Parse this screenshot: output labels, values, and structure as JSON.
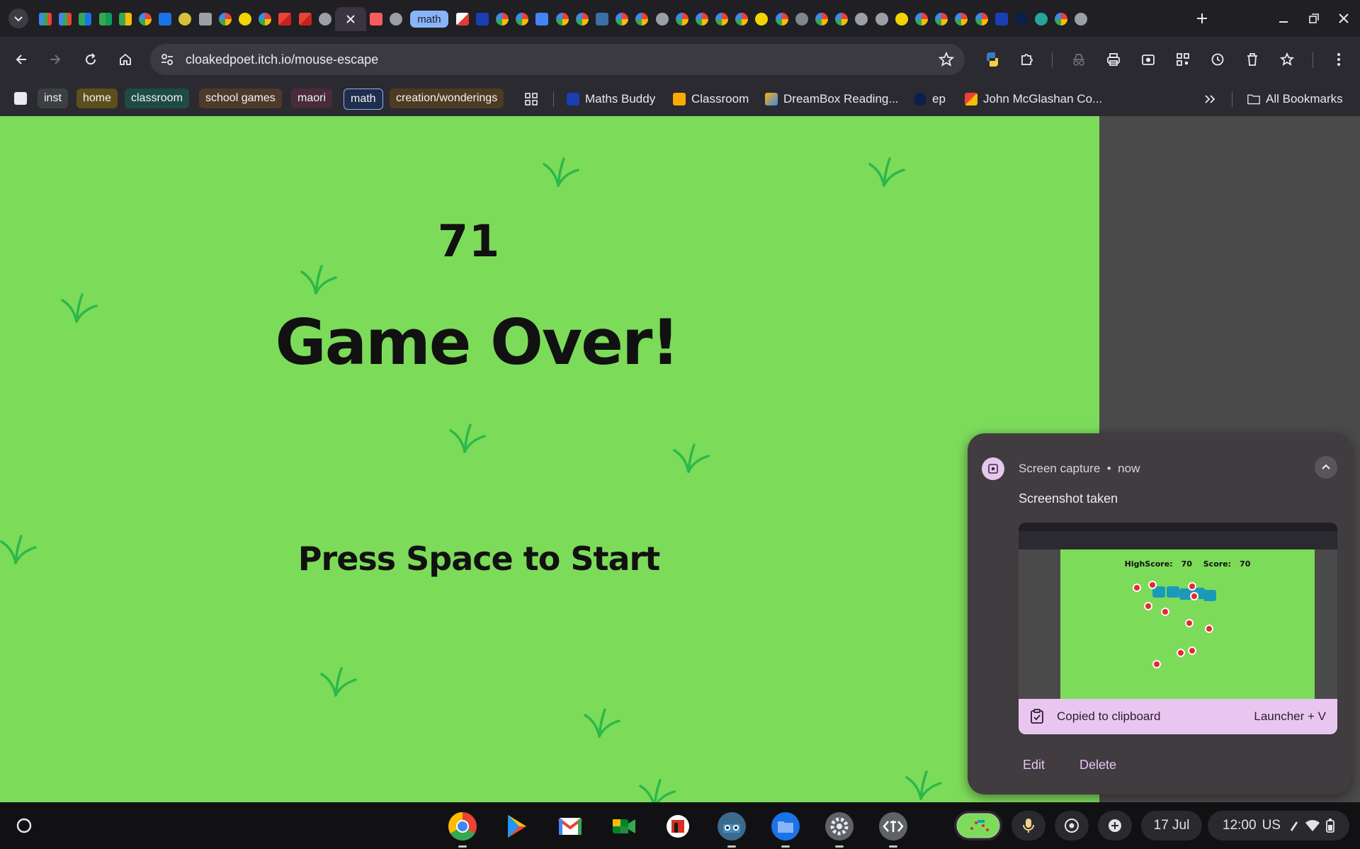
{
  "browser": {
    "tab_group_label": "math",
    "url": "cloakedpoet.itch.io/mouse-escape"
  },
  "bookmarks": {
    "chips": [
      {
        "label": "inst",
        "color": "#3c4043"
      },
      {
        "label": "home",
        "color": "#5c4f1c"
      },
      {
        "label": "classroom",
        "color": "#1e4b45"
      },
      {
        "label": "school games",
        "color": "#4d3a2a"
      },
      {
        "label": "maori",
        "color": "#4a2b3a"
      },
      {
        "label": "math",
        "color": "#1f2e4d"
      },
      {
        "label": "creation/wonderings",
        "color": "#4d3c22"
      }
    ],
    "links": [
      "Maths Buddy",
      "Classroom",
      "DreamBox Reading...",
      "ep",
      "John McGlashan Co..."
    ],
    "all_bookmarks": "All Bookmarks"
  },
  "game": {
    "score": "71",
    "title": "Game Over!",
    "prompt": "Press Space to Start"
  },
  "notification": {
    "app_name": "Screen capture",
    "time": "now",
    "title": "Screenshot taken",
    "thumbnail": {
      "highscore_label": "HighScore:",
      "highscore_value": "70",
      "score_label": "Score:",
      "score_value": "70"
    },
    "clipboard_text": "Copied to clipboard",
    "clipboard_shortcut": "Launcher + V",
    "actions": [
      "Edit",
      "Delete"
    ]
  },
  "shelf": {
    "date": "17 Jul",
    "time": "12:00",
    "locale": "US"
  },
  "colors": {
    "game_bg": "#7ddb5a",
    "grass": "#2bb84a",
    "accent": "#8ab4f8"
  }
}
